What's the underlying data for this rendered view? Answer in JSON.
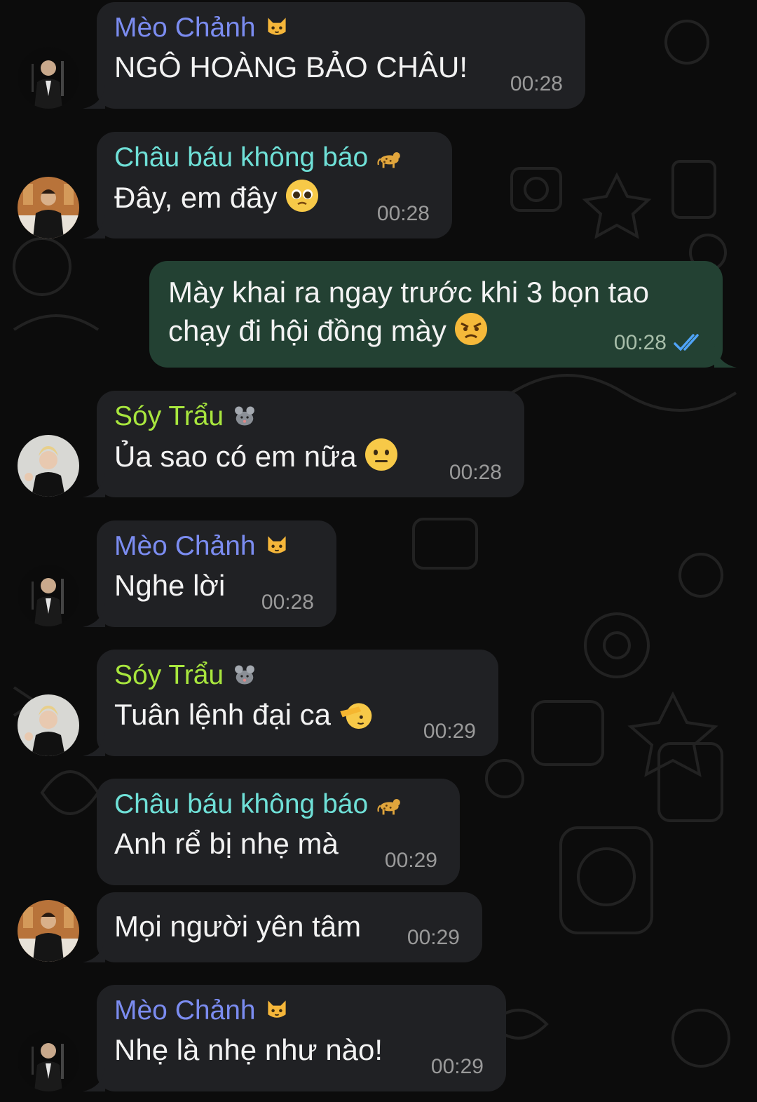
{
  "colors": {
    "background": "#0c0c0c",
    "bubble_incoming": "#202124",
    "bubble_outgoing": "#234133",
    "name_meo_chanh": "#7b8cf0",
    "name_chau_bau": "#6fe0d7",
    "name_soy_trau": "#a8e63e",
    "read_ticks": "#4fa3f7"
  },
  "messages": [
    {
      "sender": "Mèo Chảnh",
      "sender_emoji": "cat-face-icon",
      "text": "NGÔ HOÀNG BẢO CHÂU!",
      "time": "00:28",
      "avatar": "avatar-man-suit-dark"
    },
    {
      "sender": "Châu báu không báo",
      "sender_emoji": "leopard-icon",
      "text": "Đây, em đây",
      "text_emoji": "pleading-face-icon",
      "time": "00:28",
      "avatar": "avatar-man-warm-room"
    },
    {
      "outgoing": true,
      "lines": [
        "Mày khai ra ngay trước khi 3 bọn tao",
        "chạy đi hội đồng mày"
      ],
      "text_emoji": "angry-face-icon",
      "time": "00:28",
      "status": "read"
    },
    {
      "sender": "Sóy Trẩu",
      "sender_emoji": "rat-icon",
      "text": "Ủa sao có em nữa",
      "text_emoji": "neutral-face-icon",
      "time": "00:28",
      "avatar": "avatar-blond-man"
    },
    {
      "sender": "Mèo Chảnh",
      "sender_emoji": "cat-face-icon",
      "text": "Nghe lời",
      "time": "00:28",
      "avatar": "avatar-man-suit-dark"
    },
    {
      "sender": "Sóy Trẩu",
      "sender_emoji": "rat-icon",
      "text": "Tuân lệnh đại ca",
      "text_emoji": "saluting-face-icon",
      "time": "00:29",
      "avatar": "avatar-blond-man"
    },
    {
      "sender": "Châu báu không báo",
      "sender_emoji": "leopard-icon",
      "text": "Anh rể bị nhẹ mà",
      "time": "00:29"
    },
    {
      "text": "Mọi người yên tâm",
      "time": "00:29",
      "avatar": "avatar-man-warm-room"
    },
    {
      "sender": "Mèo Chảnh",
      "sender_emoji": "cat-face-icon",
      "text": "Nhẹ là nhẹ như nào!",
      "time": "00:29",
      "avatar": "avatar-man-suit-dark"
    }
  ]
}
